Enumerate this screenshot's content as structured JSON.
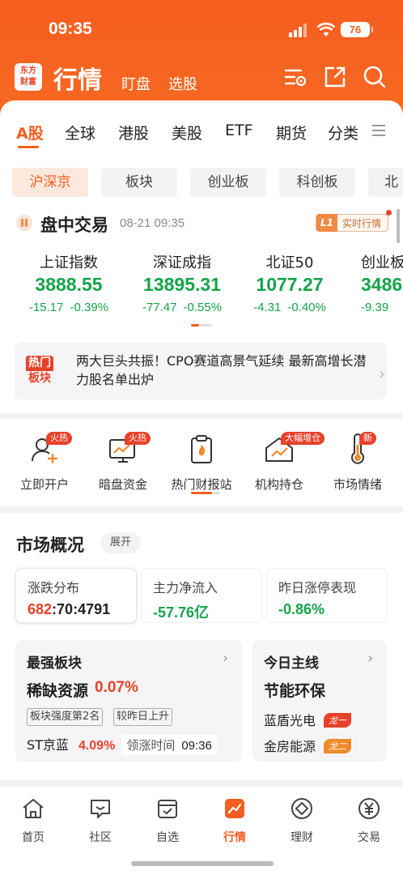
{
  "status": {
    "time": "09:35",
    "battery": "76"
  },
  "header": {
    "logo_line1": "东方",
    "logo_line2": "财富",
    "title": "行情",
    "tabs": [
      "盯盘",
      "选股"
    ]
  },
  "market_tabs": [
    "A股",
    "全球",
    "港股",
    "美股",
    "ETF",
    "期货",
    "分类"
  ],
  "sub_tabs": [
    "沪深京",
    "板块",
    "创业板",
    "科创板",
    "北交"
  ],
  "trading": {
    "title": "盘中交易",
    "time": "08-21 09:35",
    "badge_level": "L1",
    "badge_text": "实时行情"
  },
  "indices": [
    {
      "name": "上证指数",
      "value": "3888.55",
      "change": "-15.17",
      "pct": "-0.39%"
    },
    {
      "name": "深证成指",
      "value": "13895.31",
      "change": "-77.47",
      "pct": "-0.55%"
    },
    {
      "name": "北证50",
      "value": "1077.27",
      "change": "-4.31",
      "pct": "-0.40%"
    },
    {
      "name": "创业板",
      "value": "3486",
      "change": "-9.39",
      "pct": ""
    }
  ],
  "news": {
    "badge_line1": "热门",
    "badge_line2": "板块",
    "text": "两大巨头共振！CPO赛道高景气延续 最新高增长潜力股名单出炉"
  },
  "quick_actions": [
    {
      "label": "立即开户",
      "badge": "火热",
      "icon": "open-account-icon"
    },
    {
      "label": "暗盘资金",
      "badge": "火热",
      "icon": "dark-pool-icon"
    },
    {
      "label": "热门财报站",
      "badge": "",
      "icon": "earnings-report-icon"
    },
    {
      "label": "机构持仓",
      "badge": "大幅增仓",
      "icon": "institution-holdings-icon"
    },
    {
      "label": "市场情绪",
      "badge": "新",
      "icon": "market-sentiment-icon"
    }
  ],
  "overview": {
    "title": "市场概况",
    "expand": "展开",
    "stats": [
      {
        "label": "涨跌分布",
        "value_up": "682",
        "value_flat": "70",
        "value_down": "4791"
      },
      {
        "label": "主力净流入",
        "value": "-57.76亿"
      },
      {
        "label": "昨日涨停表现",
        "value": "-0.86%"
      }
    ],
    "strongest": {
      "title": "最强板块",
      "sector": "稀缺资源",
      "pct": "0.07%",
      "tags": [
        "板块强度第2名",
        "较昨日上升"
      ],
      "stock": "ST京蓝",
      "stock_pct": "4.09%",
      "lead_label": "领涨时间",
      "lead_time": "09:36"
    },
    "theme": {
      "title": "今日主线",
      "name": "节能环保",
      "stocks": [
        {
          "name": "蓝盾光电",
          "tag": "龙一"
        },
        {
          "name": "金房能源",
          "tag": "龙二"
        }
      ]
    }
  },
  "nav": [
    {
      "label": "首页",
      "icon": "home-icon"
    },
    {
      "label": "社区",
      "icon": "community-icon"
    },
    {
      "label": "自选",
      "icon": "watchlist-icon"
    },
    {
      "label": "行情",
      "icon": "market-icon"
    },
    {
      "label": "理财",
      "icon": "wealth-icon"
    },
    {
      "label": "交易",
      "icon": "trade-icon"
    }
  ],
  "colors": {
    "accent": "#f65d20",
    "up": "#e8412a",
    "down": "#16a34a"
  }
}
